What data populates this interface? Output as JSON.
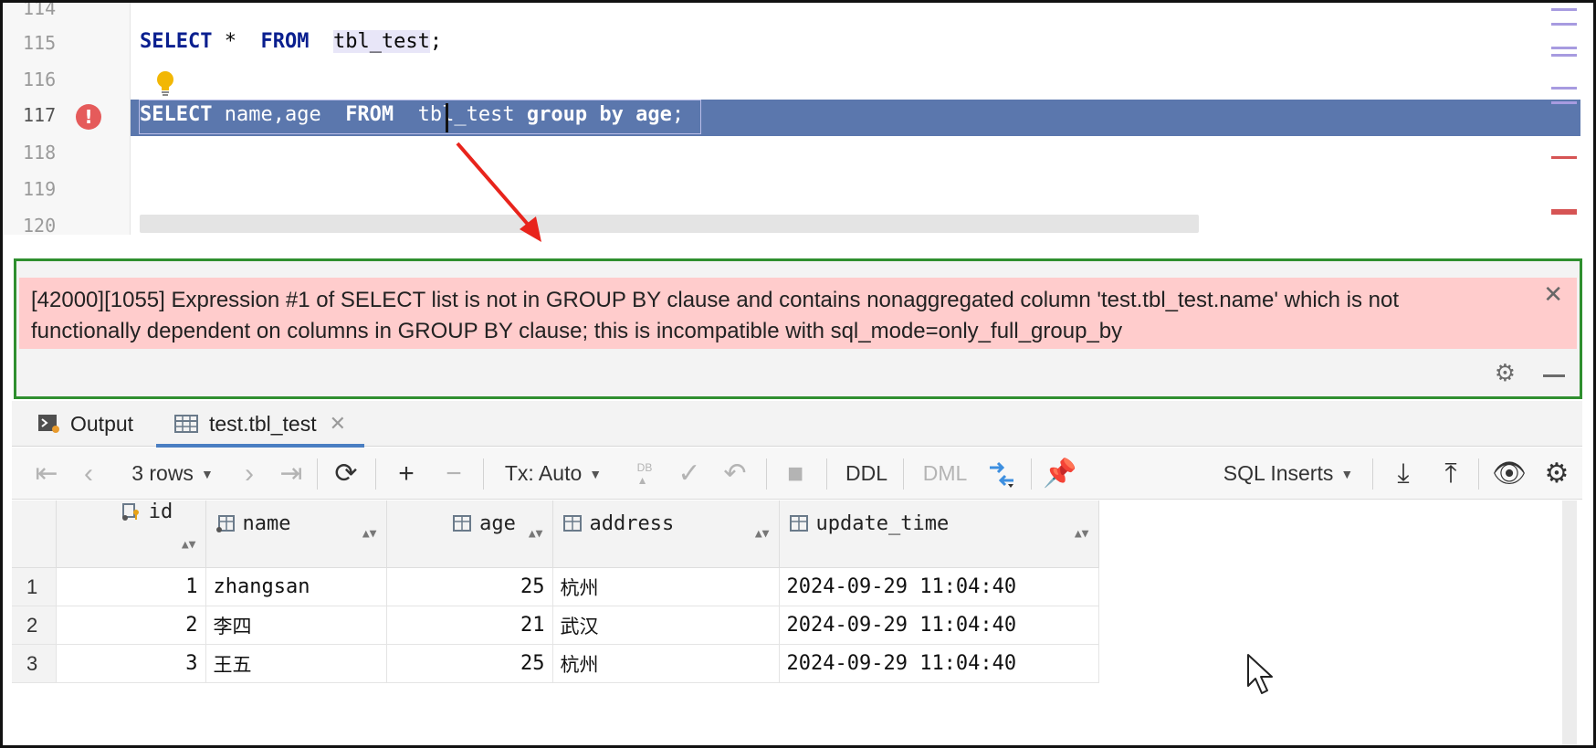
{
  "editor": {
    "line_numbers": [
      "114",
      "115",
      "116",
      "117",
      "118",
      "119",
      "120"
    ],
    "line115": {
      "kw1": "SELECT",
      "rest1": " *  ",
      "kw2": "FROM",
      "gap": "  ",
      "table": "tbl_test",
      "end": ";"
    },
    "line117": {
      "kw1": "SELECT",
      "rest1": " name,age  ",
      "kw2": "FROM",
      "gap": "  ",
      "table": "tbl_test",
      "kw3": " group by ",
      "col": "age",
      "end": ";"
    }
  },
  "error": {
    "message": "[42000][1055] Expression #1 of SELECT list is not in GROUP BY clause and contains nonaggregated column 'test.tbl_test.name' which is not functionally dependent on columns in GROUP BY clause; this is incompatible with sql_mode=only_full_group_by",
    "close": "✕"
  },
  "tabs": {
    "output": "Output",
    "result": "test.tbl_test",
    "close": "✕"
  },
  "toolbar": {
    "rows": "3 rows",
    "tx": "Tx: Auto",
    "ddl": "DDL",
    "dml": "DML",
    "format": "SQL Inserts"
  },
  "table": {
    "columns": [
      "id",
      "name",
      "age",
      "address",
      "update_time"
    ],
    "rows": [
      {
        "rn": "1",
        "id": "1",
        "name": "zhangsan",
        "age": "25",
        "address": "杭州",
        "update_time": "2024-09-29 11:04:40"
      },
      {
        "rn": "2",
        "id": "2",
        "name": "李四",
        "age": "21",
        "address": "武汉",
        "update_time": "2024-09-29 11:04:40"
      },
      {
        "rn": "3",
        "id": "3",
        "name": "王五",
        "age": "25",
        "address": "杭州",
        "update_time": "2024-09-29 11:04:40"
      }
    ]
  },
  "colors": {
    "selection": "#5b77ad",
    "error_bg": "#ffcccc",
    "highlight_box": "#2f8f2f",
    "arrow": "#e8241c",
    "keyword": "#0a1f8f"
  },
  "icons": [
    "error-icon",
    "bulb-icon",
    "close-icon",
    "gear-icon",
    "minimize-icon",
    "output-icon",
    "table-icon",
    "first-page-icon",
    "prev-page-icon",
    "next-page-icon",
    "last-page-icon",
    "refresh-icon",
    "add-row-icon",
    "delete-row-icon",
    "db-submit-icon",
    "commit-icon",
    "rollback-icon",
    "stop-icon",
    "compare-icon",
    "pin-icon",
    "download-icon",
    "upload-icon",
    "eye-icon",
    "settings-icon",
    "key-icon",
    "mouse-cursor-icon"
  ]
}
